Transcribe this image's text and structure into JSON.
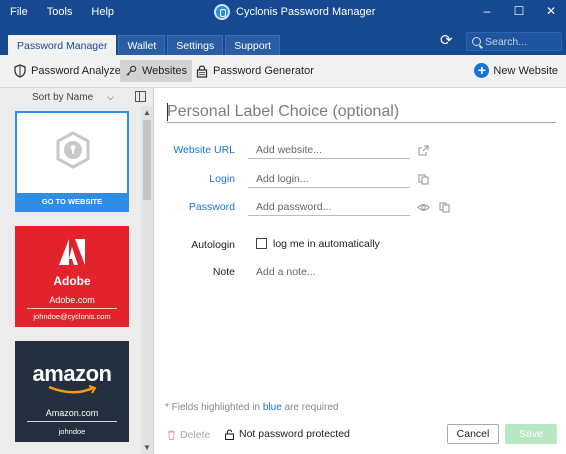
{
  "window": {
    "title": "Cyclonis Password Manager",
    "menu": [
      "File",
      "Tools",
      "Help"
    ],
    "controls": [
      "minimize",
      "maximize",
      "close"
    ]
  },
  "tabs": [
    {
      "label": "Password Manager",
      "active": true
    },
    {
      "label": "Wallet",
      "active": false
    },
    {
      "label": "Settings",
      "active": false
    },
    {
      "label": "Support",
      "active": false
    }
  ],
  "search": {
    "placeholder": "Search..."
  },
  "toolbar": {
    "analyzer": "Password Analyzer",
    "websites": "Websites",
    "generator": "Password Generator",
    "new_website": "New Website"
  },
  "sidebar": {
    "sort_label": "Sort by Name",
    "cards": [
      {
        "action": "GO TO WEBSITE"
      },
      {
        "brand": "Adobe",
        "site": "Adobe.com",
        "user": "johndoe@cyclonis.com"
      },
      {
        "brand": "amazon",
        "site": "Amazon.com",
        "user": "johndoe"
      }
    ]
  },
  "form": {
    "label_placeholder": "Personal Label Choice (optional)",
    "website_label": "Website URL",
    "website_placeholder": "Add website...",
    "login_label": "Login",
    "login_placeholder": "Add login...",
    "password_label": "Password",
    "password_placeholder": "Add password...",
    "autologin_label": "Autologin",
    "autologin_text": "log me in automatically",
    "autologin_checked": false,
    "note_label": "Note",
    "note_placeholder": "Add a note...",
    "hint_prefix": "* Fields highlighted in ",
    "hint_blue": "blue",
    "hint_suffix": " are required"
  },
  "footer": {
    "delete": "Delete",
    "protection": "Not password protected",
    "cancel": "Cancel",
    "save": "Save"
  },
  "colors": {
    "titlebar": "#16498f",
    "accent": "#1a73d9",
    "card_blue": "#2f8de4",
    "adobe_red": "#e3232b",
    "amazon_dark": "#232f3e",
    "save_disabled": "#b8e8c2"
  }
}
